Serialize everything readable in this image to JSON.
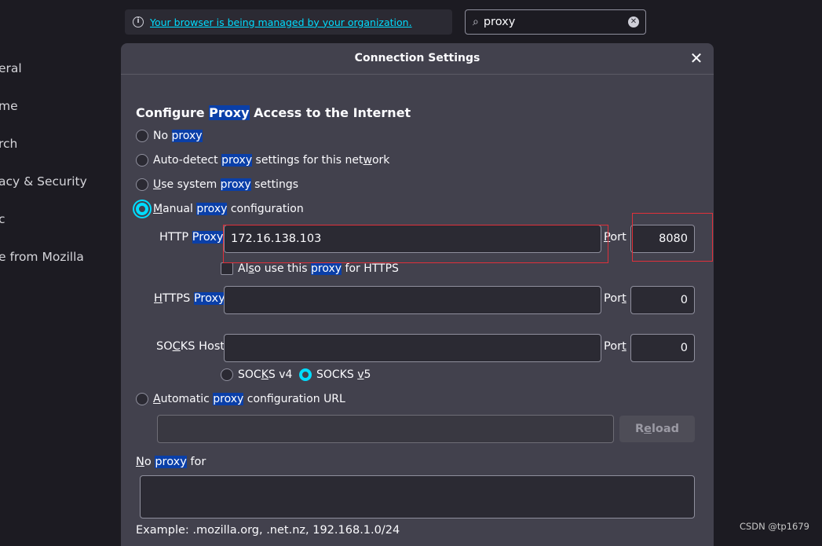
{
  "sidebar": {
    "items": [
      "eral",
      "me",
      "rch",
      "acy & Security",
      "c",
      "e from Mozilla"
    ]
  },
  "managed_banner": {
    "text": "Your browser is being managed by your organization."
  },
  "search": {
    "value": "proxy"
  },
  "dialog": {
    "title": "Connection Settings",
    "heading_a": "Configure ",
    "heading_hl": "Proxy",
    "heading_b": " Access to the Internet",
    "options": {
      "no_proxy": {
        "a": "No ",
        "hl": "proxy",
        "b": ""
      },
      "auto_detect": {
        "a": "Auto-detect ",
        "hl": "proxy",
        "b1": " settings for this net",
        "key": "w",
        "b2": "ork"
      },
      "system": {
        "key": "U",
        "a": "se system ",
        "hl": "proxy",
        "b": " settings"
      },
      "manual": {
        "key": "M",
        "a": "anual ",
        "hl": "proxy",
        "b": " configuration"
      },
      "auto_url": {
        "key": "A",
        "a": "utomatic ",
        "hl": "proxy",
        "b": " configuration URL"
      }
    },
    "http": {
      "label_a": "HTTP ",
      "label_hl": "Proxy",
      "value": "172.16.138.103",
      "port_key": "P",
      "port_rest": "ort",
      "port": "8080"
    },
    "also_https": {
      "a": "Al",
      "key": "s",
      "b": "o use this ",
      "hl": "proxy",
      "c": " for HTTPS"
    },
    "https": {
      "key": "H",
      "label_a": "TTPS ",
      "label_hl": "Proxy",
      "value": "",
      "port_a": "Por",
      "port_key": "t",
      "port": "0"
    },
    "socks": {
      "label_a": "SO",
      "key": "C",
      "label_b": "KS Host",
      "value": "",
      "port_a": "Por",
      "port_key": "t",
      "port": "0"
    },
    "socks_v4": {
      "a": "SOC",
      "key": "K",
      "b": "S v4"
    },
    "socks_v5": {
      "a": "SOCKS ",
      "key": "v",
      "b": "5"
    },
    "auto_url_value": "",
    "reload": {
      "a": "R",
      "key": "e",
      "b": "load"
    },
    "no_proxy_for": {
      "key": "N",
      "a": "o ",
      "hl": "proxy",
      "b": " for"
    },
    "no_proxy_value": "",
    "example": "Example: .mozilla.org, .net.nz, 192.168.1.0/24"
  },
  "watermark": "CSDN @tp1679",
  "colors": {
    "accent": "#00ddff",
    "highlight": "#0a3fa8",
    "annotation": "#e0303a"
  },
  "icons": [
    "info-icon",
    "search-icon",
    "clear-icon",
    "close-icon"
  ]
}
